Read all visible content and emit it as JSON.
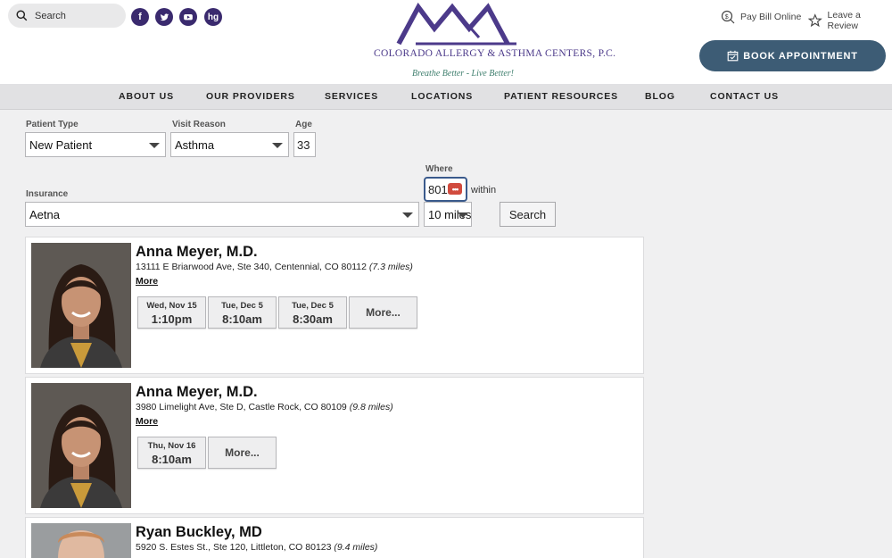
{
  "header": {
    "search_placeholder": "Search",
    "social_icons": [
      "facebook-icon",
      "twitter-icon",
      "youtube-icon",
      "healthgrades-icon"
    ],
    "healthgrades_label": "hg",
    "logo_text": "COLORADO ALLERGY & ASTHMA CENTERS, P.C.",
    "logo_tagline": "Breathe Better - Live Better!",
    "pay_bill": "Pay Bill Online",
    "leave_review": "Leave a Review",
    "book_appointment": "BOOK APPOINTMENT",
    "colors": {
      "brand_purple": "#4c3a8a",
      "button_blue": "#3d5c75"
    }
  },
  "nav": {
    "items": [
      "ABOUT US",
      "OUR PROVIDERS",
      "SERVICES",
      "LOCATIONS",
      "PATIENT RESOURCES",
      "BLOG",
      "CONTACT US"
    ]
  },
  "form": {
    "patient_type_label": "Patient Type",
    "patient_type_value": "New Patient",
    "visit_reason_label": "Visit Reason",
    "visit_reason_value": "Asthma",
    "age_label": "Age",
    "age_value": "33",
    "where_label": "Where",
    "where_value": "8012",
    "within_label": "within",
    "insurance_label": "Insurance",
    "insurance_value": "Aetna",
    "distance_value": "10 miles",
    "search_button": "Search"
  },
  "results": [
    {
      "name": "Anna Meyer, M.D.",
      "address": "13111 E Briarwood Ave, Ste 340, Centennial, CO 80112",
      "distance": "(7.3 miles)",
      "more": "More",
      "slots": [
        {
          "date": "Wed, Nov 15",
          "time": "1:10pm"
        },
        {
          "date": "Tue, Dec 5",
          "time": "8:10am"
        },
        {
          "date": "Tue, Dec 5",
          "time": "8:30am"
        }
      ],
      "more_slots": "More..."
    },
    {
      "name": "Anna Meyer, M.D.",
      "address": "3980 Limelight Ave, Ste D, Castle Rock, CO 80109",
      "distance": "(9.8 miles)",
      "more": "More",
      "slots": [
        {
          "date": "Thu, Nov 16",
          "time": "8:10am"
        }
      ],
      "more_slots": "More..."
    },
    {
      "name": "Ryan Buckley, MD",
      "address": "5920 S. Estes St., Ste 120, Littleton, CO 80123",
      "distance": "(9.4 miles)"
    }
  ]
}
